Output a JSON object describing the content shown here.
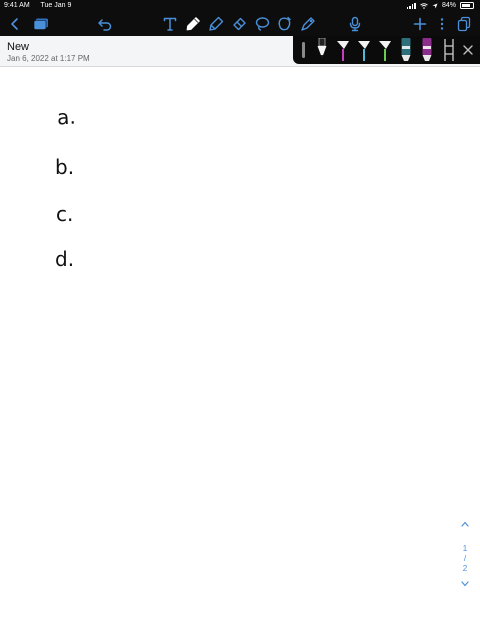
{
  "status_bar": {
    "time": "9:41 AM",
    "date": "Tue Jan 9",
    "battery": "84%"
  },
  "toolbar": {
    "icons": [
      "back-icon",
      "notebooks-icon",
      "undo-icon",
      "text-tool-icon",
      "pen-icon",
      "highlighter-icon",
      "eraser-icon",
      "lasso-icon",
      "shapes-icon",
      "color-icon",
      "microphone-icon",
      "add-icon",
      "more-icon",
      "pages-icon"
    ]
  },
  "document": {
    "title": "New",
    "date": "Jan 6, 2022 at 1:17 PM"
  },
  "pen_tray": {
    "colors": [
      "#222222",
      "#c33fbf",
      "#4fb7d9",
      "#6acb4f",
      "#2d6f7a",
      "#8c2c8c"
    ],
    "close_icon": "close-icon"
  },
  "canvas": {
    "labels": [
      "a.",
      "b.",
      "c.",
      "d."
    ]
  },
  "pager": {
    "current": "1",
    "separator": "/",
    "total": "2"
  }
}
